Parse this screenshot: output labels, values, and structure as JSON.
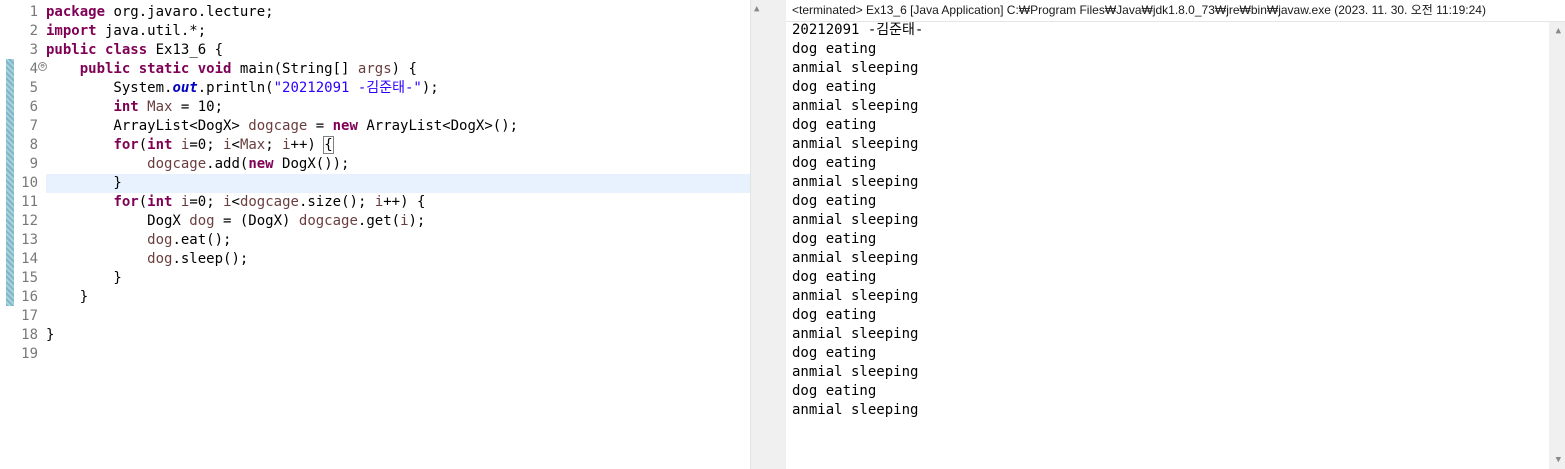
{
  "editor": {
    "line_numbers": [
      "1",
      "2",
      "3",
      "4",
      "5",
      "6",
      "7",
      "8",
      "9",
      "10",
      "11",
      "12",
      "13",
      "14",
      "15",
      "16",
      "17",
      "18",
      "19"
    ],
    "fold_marker": "⊖",
    "lines": [
      [
        {
          "t": "package",
          "c": "kw"
        },
        {
          "t": " org.javaro.lecture;"
        }
      ],
      [
        {
          "t": "import",
          "c": "kw"
        },
        {
          "t": " java.util.*;"
        }
      ],
      [
        {
          "t": "public",
          "c": "kw"
        },
        {
          "t": " "
        },
        {
          "t": "class",
          "c": "kw"
        },
        {
          "t": " Ex13_6 {"
        }
      ],
      [
        {
          "t": "    "
        },
        {
          "t": "public",
          "c": "kw"
        },
        {
          "t": " "
        },
        {
          "t": "static",
          "c": "kw"
        },
        {
          "t": " "
        },
        {
          "t": "void",
          "c": "kw"
        },
        {
          "t": " main(String[] "
        },
        {
          "t": "args",
          "c": "var"
        },
        {
          "t": ") {"
        }
      ],
      [
        {
          "t": "        System."
        },
        {
          "t": "out",
          "c": "fld"
        },
        {
          "t": ".println("
        },
        {
          "t": "\"20212091 -김준태-\"",
          "c": "str"
        },
        {
          "t": ");"
        }
      ],
      [
        {
          "t": "        "
        },
        {
          "t": "int",
          "c": "kw"
        },
        {
          "t": " "
        },
        {
          "t": "Max",
          "c": "var"
        },
        {
          "t": " = 10;"
        }
      ],
      [
        {
          "t": "        ArrayList<DogX> "
        },
        {
          "t": "dogcage",
          "c": "var"
        },
        {
          "t": " = "
        },
        {
          "t": "new",
          "c": "kw"
        },
        {
          "t": " ArrayList<DogX>();"
        }
      ],
      [
        {
          "t": "        "
        },
        {
          "t": "for",
          "c": "kw"
        },
        {
          "t": "("
        },
        {
          "t": "int",
          "c": "kw"
        },
        {
          "t": " "
        },
        {
          "t": "i",
          "c": "var"
        },
        {
          "t": "=0; "
        },
        {
          "t": "i",
          "c": "var"
        },
        {
          "t": "<"
        },
        {
          "t": "Max",
          "c": "var"
        },
        {
          "t": "; "
        },
        {
          "t": "i",
          "c": "var"
        },
        {
          "t": "++) "
        },
        {
          "t": "{",
          "c": "bracket-box"
        }
      ],
      [
        {
          "t": "            "
        },
        {
          "t": "dogcage",
          "c": "var"
        },
        {
          "t": ".add("
        },
        {
          "t": "new",
          "c": "kw"
        },
        {
          "t": " DogX());"
        }
      ],
      [
        {
          "t": "        }"
        }
      ],
      [
        {
          "t": "        "
        },
        {
          "t": "for",
          "c": "kw"
        },
        {
          "t": "("
        },
        {
          "t": "int",
          "c": "kw"
        },
        {
          "t": " "
        },
        {
          "t": "i",
          "c": "var"
        },
        {
          "t": "=0; "
        },
        {
          "t": "i",
          "c": "var"
        },
        {
          "t": "<"
        },
        {
          "t": "dogcage",
          "c": "var"
        },
        {
          "t": ".size(); "
        },
        {
          "t": "i",
          "c": "var"
        },
        {
          "t": "++) {"
        }
      ],
      [
        {
          "t": "            DogX "
        },
        {
          "t": "dog",
          "c": "var"
        },
        {
          "t": " = (DogX) "
        },
        {
          "t": "dogcage",
          "c": "var"
        },
        {
          "t": ".get("
        },
        {
          "t": "i",
          "c": "var"
        },
        {
          "t": ");"
        }
      ],
      [
        {
          "t": "            "
        },
        {
          "t": "dog",
          "c": "var"
        },
        {
          "t": ".eat();"
        }
      ],
      [
        {
          "t": "            "
        },
        {
          "t": "dog",
          "c": "var"
        },
        {
          "t": ".sleep();"
        }
      ],
      [
        {
          "t": "        }"
        }
      ],
      [
        {
          "t": "    }"
        }
      ],
      [
        {
          "t": ""
        }
      ],
      [
        {
          "t": "}"
        }
      ],
      [
        {
          "t": ""
        }
      ]
    ]
  },
  "console": {
    "header": "<terminated> Ex13_6 [Java Application] C:₩Program Files₩Java₩jdk1.8.0_73₩jre₩bin₩javaw.exe (2023. 11. 30. 오전 11:19:24)",
    "output": [
      "20212091 -김준태-",
      "dog eating",
      "anmial sleeping",
      "dog eating",
      "anmial sleeping",
      "dog eating",
      "anmial sleeping",
      "dog eating",
      "anmial sleeping",
      "dog eating",
      "anmial sleeping",
      "dog eating",
      "anmial sleeping",
      "dog eating",
      "anmial sleeping",
      "dog eating",
      "anmial sleeping",
      "dog eating",
      "anmial sleeping",
      "dog eating",
      "anmial sleeping"
    ]
  },
  "colors": {
    "keyword": "#7f0055",
    "string": "#2a00ff",
    "static_field": "#0000c0",
    "local_variable": "#6a3e3e",
    "current_line": "#e8f2fe",
    "line_number": "#787878"
  },
  "scroll_icons": {
    "up": "▲",
    "down": "▼"
  }
}
